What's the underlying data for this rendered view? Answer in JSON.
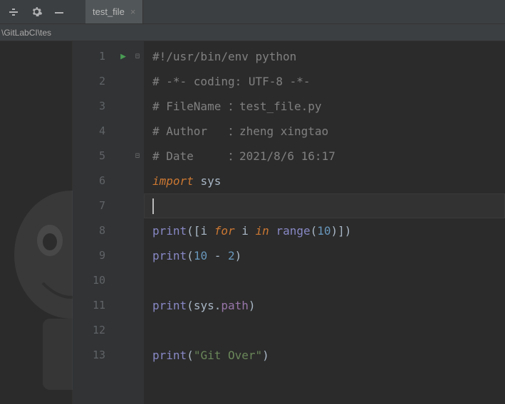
{
  "tab": {
    "label": "test_file",
    "close": "×"
  },
  "path": "\\GitLabCI\\tes",
  "lines": {
    "l1": "#!/usr/bin/env python",
    "l2": "# -*- coding: UTF-8 -*-",
    "l3": "# FileName ：test_file.py",
    "l4": "# Author   ：zheng xingtao",
    "l5": "# Date     ：2021/8/6 16:17",
    "l6_import": "import",
    "l6_sys": "sys",
    "l8_print": "print",
    "l8_i1": "i",
    "l8_for": "for",
    "l8_i2": "i",
    "l8_in": "in",
    "l8_range": "range",
    "l8_num": "10",
    "l9_print": "print",
    "l9_a": "10",
    "l9_b": "2",
    "l11_print": "print",
    "l11_sys": "sys",
    "l11_path": "path",
    "l13_print": "print",
    "l13_str": "\"Git Over\""
  },
  "numbers": [
    "1",
    "2",
    "3",
    "4",
    "5",
    "6",
    "7",
    "8",
    "9",
    "10",
    "11",
    "12",
    "13"
  ]
}
